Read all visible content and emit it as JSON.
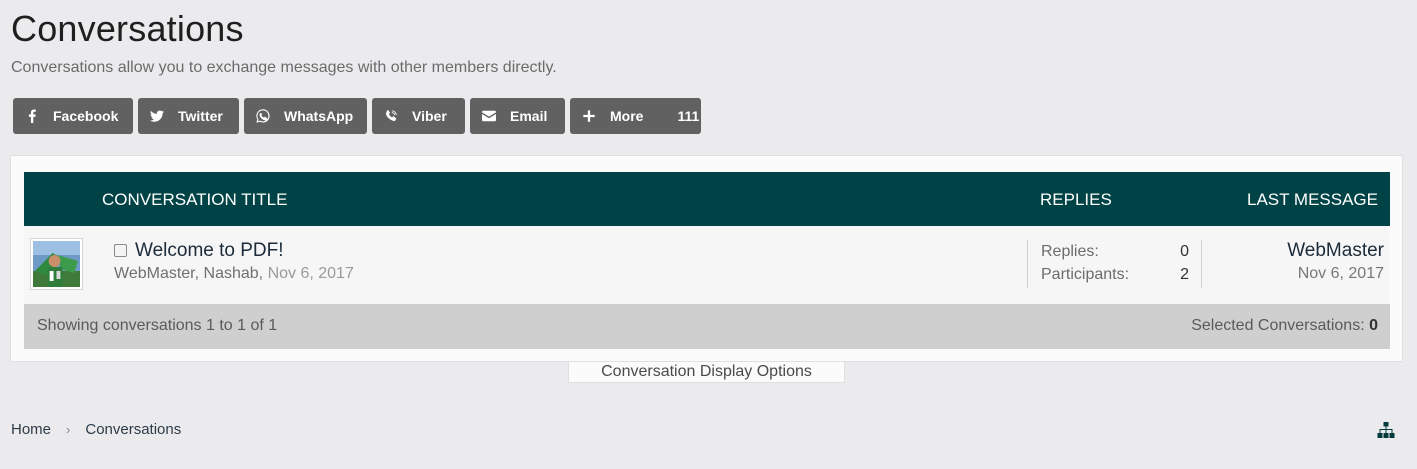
{
  "page": {
    "title": "Conversations",
    "description": "Conversations allow you to exchange messages with other members directly."
  },
  "share": {
    "buttons": [
      {
        "label": "Facebook",
        "icon": "facebook-icon"
      },
      {
        "label": "Twitter",
        "icon": "twitter-icon"
      },
      {
        "label": "WhatsApp",
        "icon": "whatsapp-icon"
      },
      {
        "label": "Viber",
        "icon": "viber-icon"
      },
      {
        "label": "Email",
        "icon": "email-icon"
      },
      {
        "label": "More",
        "icon": "plus-icon",
        "count": "111"
      }
    ]
  },
  "table": {
    "headers": {
      "title": "CONVERSATION TITLE",
      "replies": "REPLIES",
      "last_message": "LAST MESSAGE"
    },
    "rows": [
      {
        "title": "Welcome to PDF!",
        "participants_names": "WebMaster, Nashab,",
        "date": "Nov 6, 2017",
        "replies_label": "Replies:",
        "replies_value": "0",
        "participants_label": "Participants:",
        "participants_value": "2",
        "last_user": "WebMaster",
        "last_date": "Nov 6, 2017"
      }
    ],
    "footer": {
      "showing": "Showing conversations 1 to 1 of 1",
      "selected_label": "Selected Conversations:",
      "selected_count": "0"
    }
  },
  "display_options": "Conversation Display Options",
  "breadcrumb": [
    "Home",
    "Conversations"
  ],
  "colors": {
    "header_bg": "#004346",
    "button_bg": "#616161",
    "page_bg": "#ebebee"
  }
}
